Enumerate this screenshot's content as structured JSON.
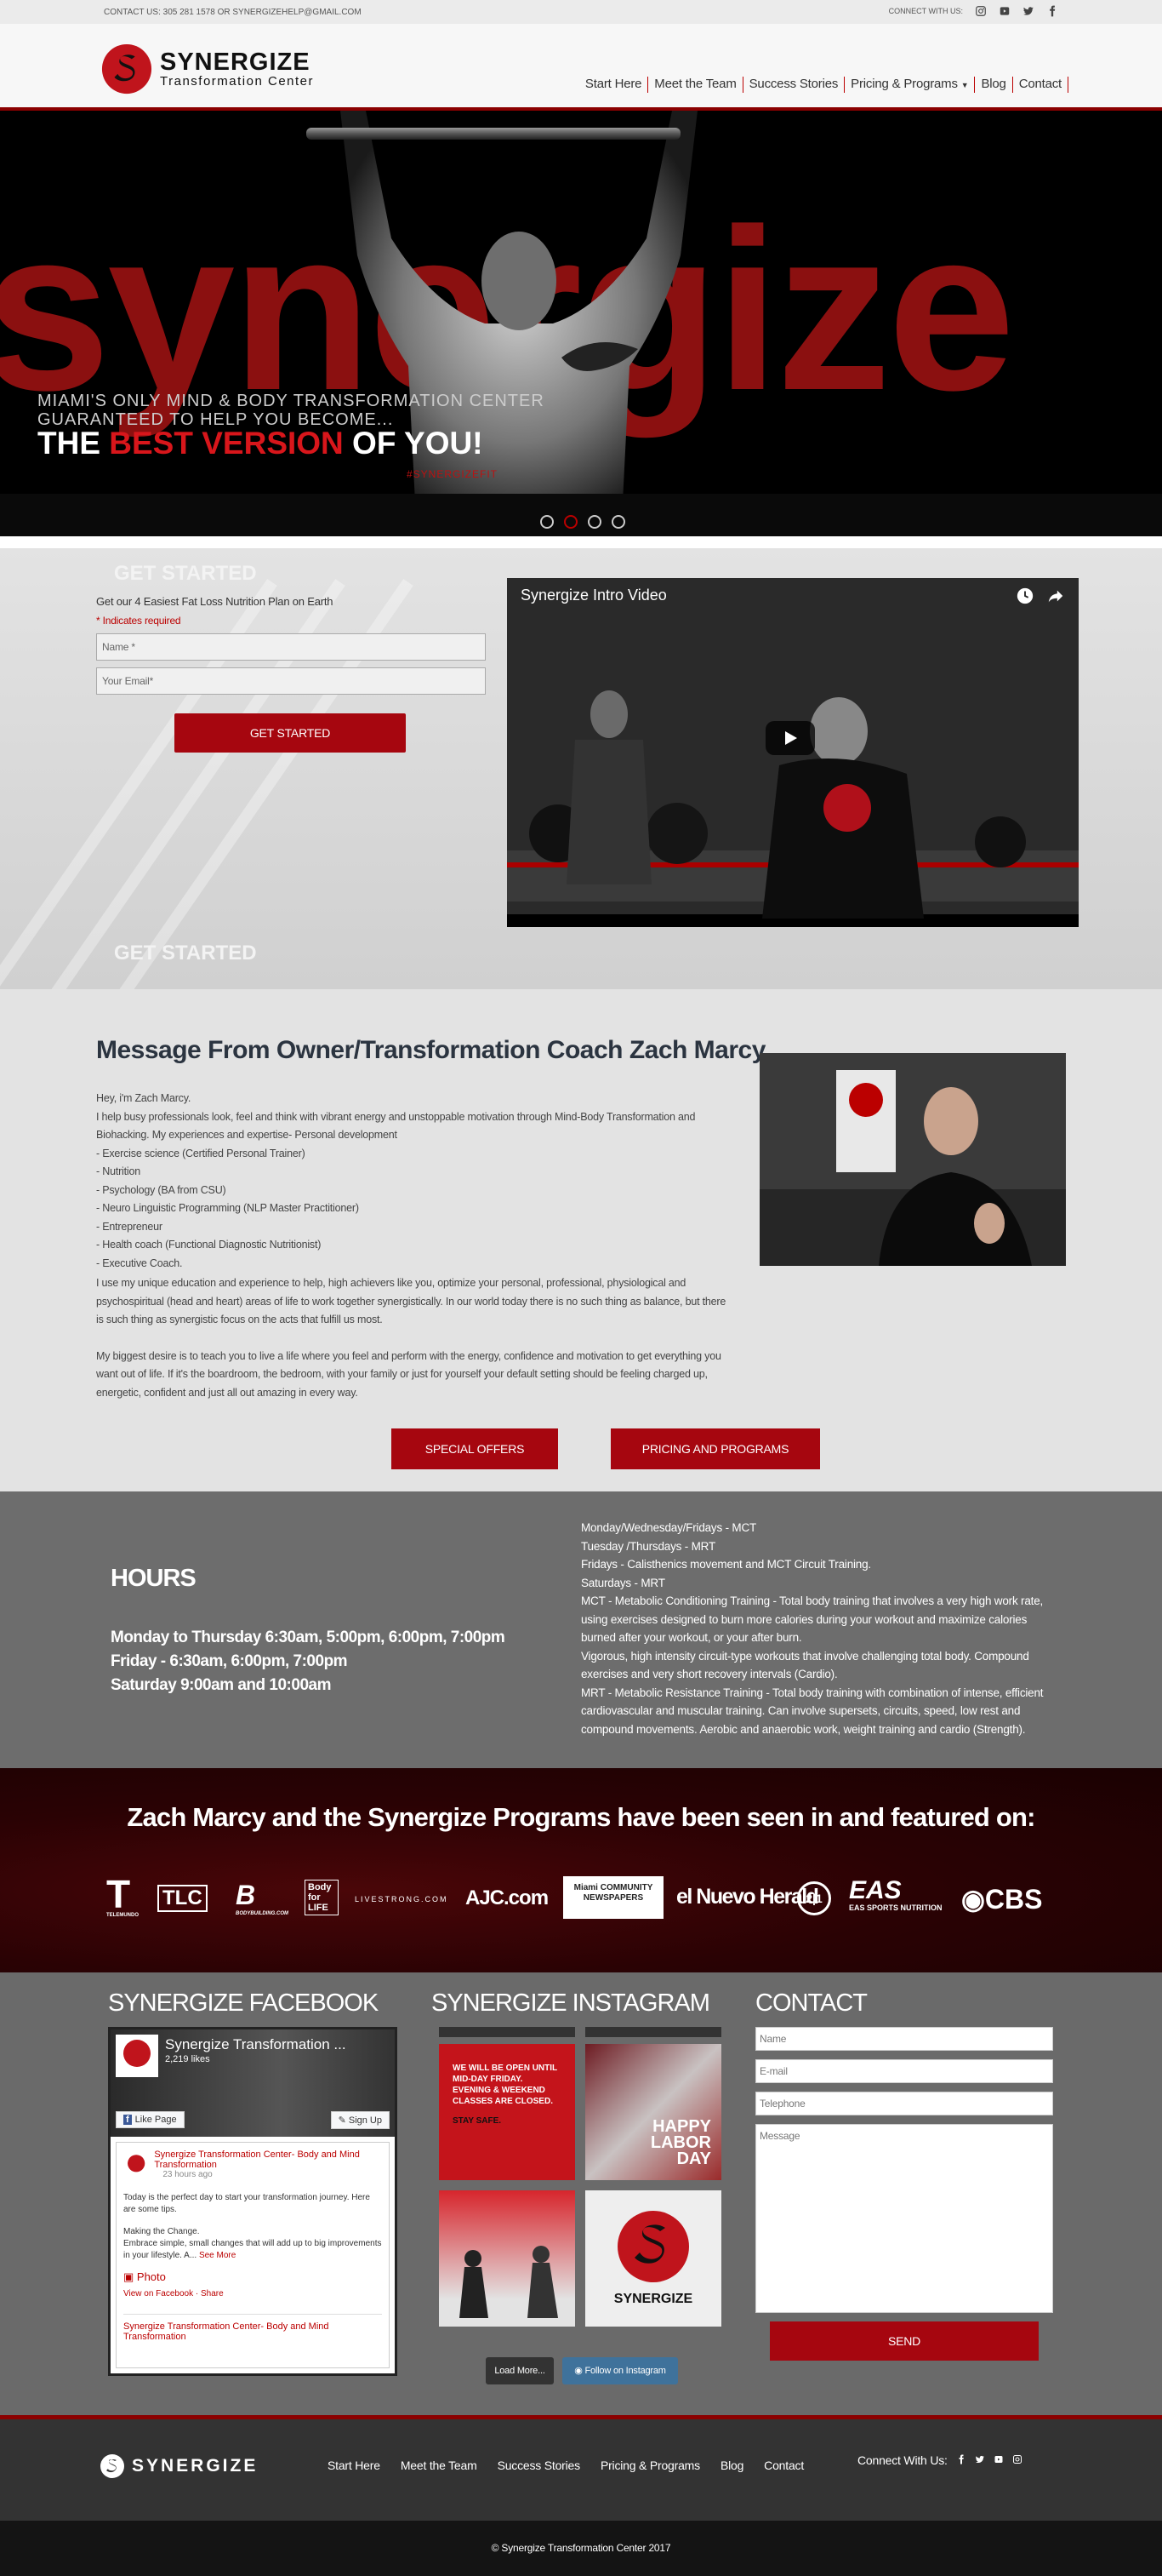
{
  "topbar": {
    "contact": "CONTACT US: 305 281 1578 OR SYNERGIZEHELP@GMAIL.COM",
    "connect": "CONNECT WITH US:",
    "icons": [
      "instagram-icon",
      "youtube-icon",
      "twitter-icon",
      "facebook-icon"
    ]
  },
  "logo": {
    "name": "SYNERGIZE",
    "subtitle": "Transformation Center"
  },
  "nav": [
    "Start Here",
    "Meet the Team",
    "Success Stories",
    "Pricing & Programs",
    "Blog",
    "Contact"
  ],
  "hero": {
    "big": "synergize",
    "line1a": "MIAMI'S ONLY MIND & BODY TRANSFORMATION CENTER",
    "line1b": "GUARANTEED TO HELP YOU BECOME...",
    "pre": "THE ",
    "highlight": "BEST VERSION",
    "post": " OF YOU!",
    "tag": "#SYNERGIZEFIT",
    "slides": 4,
    "active_slide": 2
  },
  "signup": {
    "ghost": "GET STARTED",
    "sub": "Get our 4 Easiest Fat Loss Nutrition Plan on Earth",
    "required": "* Indicates required",
    "name_ph": "Name *",
    "email_ph": "Your Email*",
    "button": "GET STARTED"
  },
  "video": {
    "title": "Synergize Intro Video"
  },
  "message": {
    "heading": "Message From Owner/Transformation Coach Zach Marcy",
    "p1": [
      "Hey, i'm Zach Marcy.",
      "I help busy professionals look, feel and think with vibrant energy and unstoppable motivation through Mind-Body Transformation and Biohacking. My experiences and expertise- Personal development",
      "- Exercise science (Certified Personal Trainer)",
      "- Nutrition",
      "- Psychology (BA from CSU)",
      "- Neuro Linguistic Programming (NLP Master Practitioner)",
      "- Entrepreneur",
      "- Health coach (Functional Diagnostic Nutritionist)",
      "- Executive Coach."
    ],
    "p2": "I use my unique education and experience to help, high achievers like you, optimize your personal, professional, physiological and psychospiritual (head and heart) areas of life to work together synergistically. In our world today there is no such thing as balance, but there is such thing as synergistic focus on the acts that fulfill us most.",
    "p3": "My biggest desire is to teach you to live a life where you feel and perform with the energy, confidence and motivation to get everything you want out of life. If it's the boardroom, the bedroom, with your family or just for yourself your default setting should be feeling charged up, energetic, confident and just all out amazing in every way.",
    "btn1": "SPECIAL OFFERS",
    "btn2": "PRICING AND PROGRAMS"
  },
  "hours": {
    "heading": "HOURS",
    "times": [
      "Monday to Thursday 6:30am, 5:00pm, 6:00pm, 7:00pm",
      "Friday - 6:30am, 6:00pm, 7:00pm",
      "Saturday 9:00am and 10:00am"
    ],
    "schedule": [
      "Monday/Wednesday/Fridays - MCT",
      "Tuesday /Thursdays - MRT",
      "Fridays - Calisthenics movement and MCT Circuit Training.",
      "Saturdays - MRT",
      "MCT - Metabolic Conditioning Training - Total body training that involves a very high work rate, using exercises designed to burn more calories during your workout and maximize calories burned after your workout, or your after burn.",
      "Vigorous, high intensity circuit-type workouts that involve challenging total body. Compound exercises and very short recovery intervals (Cardio).",
      "MRT - Metabolic Resistance Training - Total body training with combination of intense, efficient cardiovascular and muscular training. Can involve supersets, circuits, speed, low rest and compound movements. Aerobic and anaerobic work, weight training and cardio (Strength)."
    ]
  },
  "featured": {
    "heading": "Zach Marcy and the Synergize Programs have been seen in and featured on:",
    "logos": [
      "TELEMUNDO",
      "TLC",
      "BODYBUILDING.COM",
      "Body for LIFE",
      "LIVESTRONG.COM",
      "AJC.com",
      "Miami COMMUNITY NEWSPAPERS",
      "el Nuevo Herald",
      "2|1",
      "EAS SPORTS NUTRITION",
      "CBS"
    ]
  },
  "facebook": {
    "heading": "SYNERGIZE FACEBOOK",
    "page": "Synergize Transformation ...",
    "likes": "2,219 likes",
    "like_btn": "Like Page",
    "signup_btn": "Sign Up",
    "post_author": "Synergize Transformation Center- Body and Mind Transformation",
    "post_time": "23 hours ago",
    "post_text1": "Today is the perfect day to start your transformation journey. Here are some tips.",
    "post_text2": "Making the Change.",
    "post_text3": "Embrace simple, small changes that will add up to big improvements in your lifestyle. A...",
    "see_more": "See More",
    "photo": "Photo",
    "view_fb": "View on Facebook",
    "share": "Share",
    "post2_author": "Synergize Transformation Center- Body and Mind Transformation"
  },
  "instagram": {
    "heading": "SYNERGIZE INSTAGRAM",
    "tile1": "WE WILL BE OPEN UNTIL MID-DAY FRIDAY. EVENING & WEEKEND CLASSES ARE CLOSED.",
    "tile1b": "STAY SAFE.",
    "tile2a": "HAPPY",
    "tile2b": "LABOR",
    "tile2c": "DAY",
    "load": "Load More...",
    "follow": "Follow on Instagram"
  },
  "contact": {
    "heading": "CONTACT",
    "name_ph": "Name",
    "email_ph": "E-mail",
    "phone_ph": "Telephone",
    "msg_ph": "Message",
    "send": "SEND"
  },
  "footer": {
    "logo": "SYNERGIZE",
    "nav": [
      "Start Here",
      "Meet the Team",
      "Success Stories",
      "Pricing & Programs",
      "Blog",
      "Contact"
    ],
    "connect": "Connect With Us:",
    "copyright": "© Synergize Transformation Center 2017"
  },
  "colors": {
    "accent": "#a6060f",
    "dark_red": "#8b0000",
    "gray": "#6d6d6d"
  }
}
